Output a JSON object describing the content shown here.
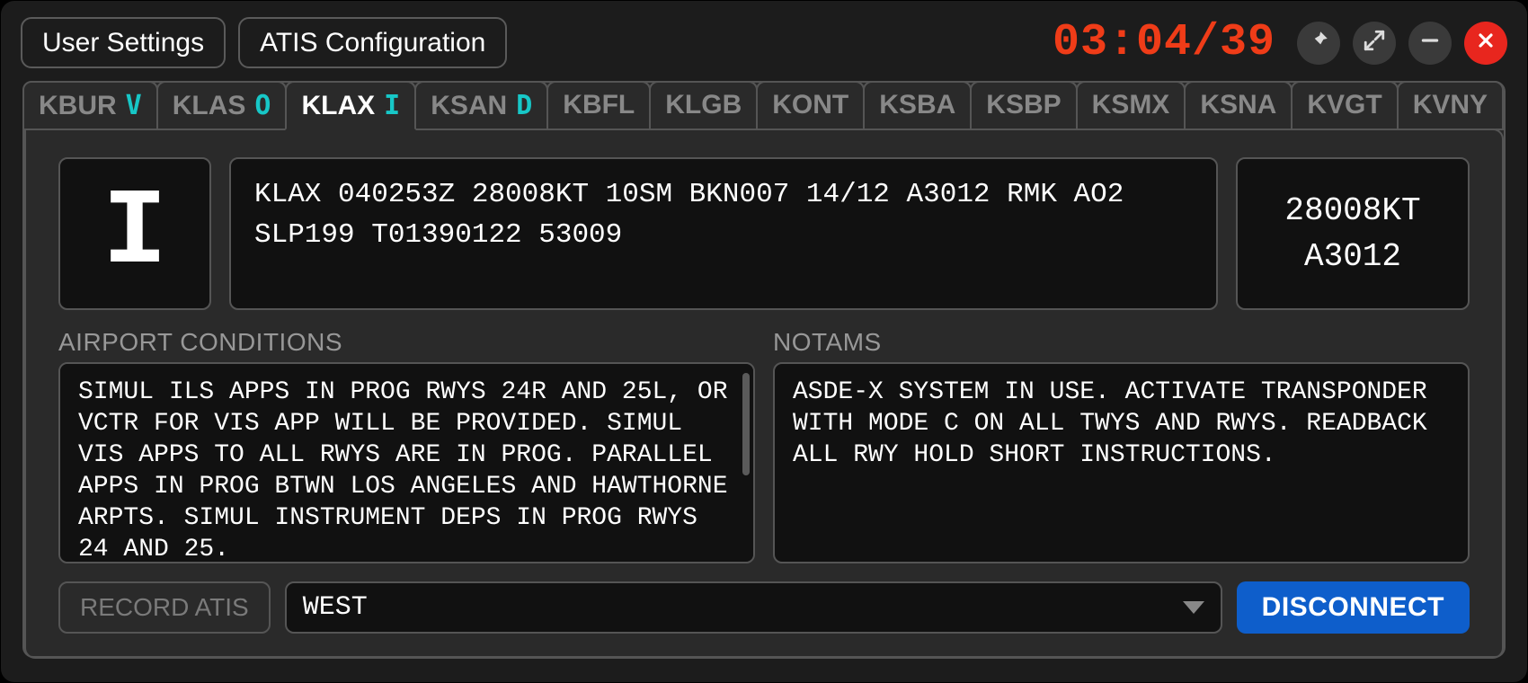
{
  "header": {
    "user_settings_label": "User Settings",
    "atis_config_label": "ATIS Configuration",
    "clock": "03:04/39"
  },
  "tabs": [
    {
      "icao": "KBUR",
      "letter": "V",
      "active": false
    },
    {
      "icao": "KLAS",
      "letter": "O",
      "active": false
    },
    {
      "icao": "KLAX",
      "letter": "I",
      "active": true
    },
    {
      "icao": "KSAN",
      "letter": "D",
      "active": false
    },
    {
      "icao": "KBFL",
      "letter": "",
      "active": false
    },
    {
      "icao": "KLGB",
      "letter": "",
      "active": false
    },
    {
      "icao": "KONT",
      "letter": "",
      "active": false
    },
    {
      "icao": "KSBA",
      "letter": "",
      "active": false
    },
    {
      "icao": "KSBP",
      "letter": "",
      "active": false
    },
    {
      "icao": "KSMX",
      "letter": "",
      "active": false
    },
    {
      "icao": "KSNA",
      "letter": "",
      "active": false
    },
    {
      "icao": "KVGT",
      "letter": "",
      "active": false
    },
    {
      "icao": "KVNY",
      "letter": "",
      "active": false
    }
  ],
  "atis": {
    "letter": "I",
    "metar": "KLAX 040253Z 28008KT 10SM BKN007 14/12 A3012 RMK AO2 SLP199 T01390122 53009",
    "wind": "28008KT",
    "altimeter": "A3012"
  },
  "airport_conditions": {
    "label": "AIRPORT CONDITIONS",
    "text": "SIMUL ILS APPS IN PROG RWYS 24R AND 25L, OR VCTR FOR VIS APP WILL BE PROVIDED. SIMUL VIS APPS TO ALL RWYS ARE IN PROG. PARALLEL APPS IN PROG BTWN LOS ANGELES AND HAWTHORNE ARPTS. SIMUL INSTRUMENT DEPS IN PROG RWYS 24 AND 25."
  },
  "notams": {
    "label": "NOTAMS",
    "text": "ASDE-X SYSTEM IN USE. ACTIVATE TRANSPONDER WITH MODE C ON ALL TWYS AND RWYS. READBACK ALL RWY HOLD SHORT INSTRUCTIONS."
  },
  "footer": {
    "record_label": "RECORD ATIS",
    "direction_value": "WEST",
    "disconnect_label": "DISCONNECT"
  }
}
